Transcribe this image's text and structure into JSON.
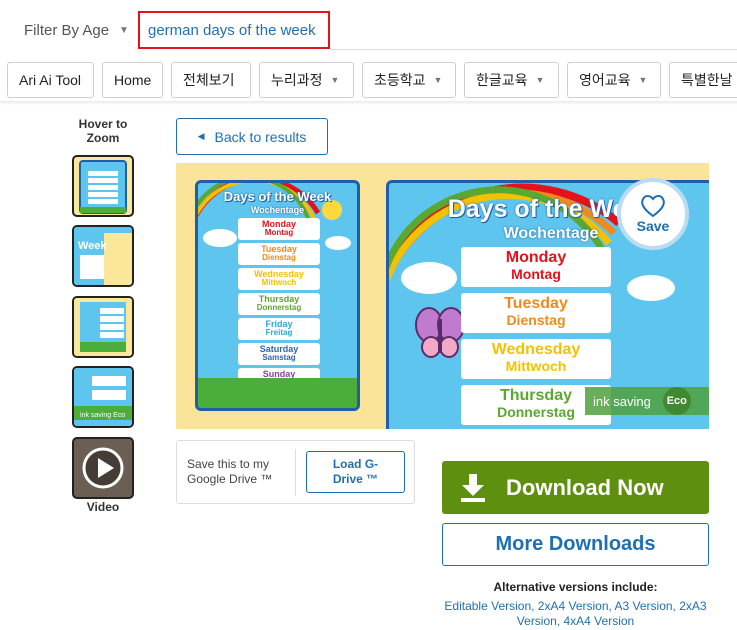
{
  "filter": {
    "label": "Filter By Age"
  },
  "search": {
    "value": "german days of the week"
  },
  "nav": [
    {
      "label": "Ari Ai Tool",
      "dropdown": false
    },
    {
      "label": "Home",
      "dropdown": false
    },
    {
      "label": "전체보기",
      "dropdown": false
    },
    {
      "label": "누리과정",
      "dropdown": true
    },
    {
      "label": "초등학교",
      "dropdown": true
    },
    {
      "label": "한글교육",
      "dropdown": true
    },
    {
      "label": "영어교육",
      "dropdown": true
    },
    {
      "label": "특별한날",
      "dropdown": false
    }
  ],
  "sidebar": {
    "hover_label": "Hover to Zoom",
    "video_label": "Video"
  },
  "back": {
    "label": "Back to results"
  },
  "resource": {
    "title": "Days of the Week",
    "subtitle": "Wochentage",
    "days": [
      {
        "en": "Monday",
        "de": "Montag",
        "color": "#e4131b"
      },
      {
        "en": "Tuesday",
        "de": "Dienstag",
        "color": "#f08a1c"
      },
      {
        "en": "Wednesday",
        "de": "Mittwoch",
        "color": "#f2c200"
      },
      {
        "en": "Thursday",
        "de": "Donnerstag",
        "color": "#59a832"
      },
      {
        "en": "Friday",
        "de": "Freitag",
        "color": "#2aa7d6"
      },
      {
        "en": "Saturday",
        "de": "Samstag",
        "color": "#2d63b0"
      },
      {
        "en": "Sunday",
        "de": "Sonntag",
        "color": "#8a3fa0"
      }
    ]
  },
  "save": {
    "label": "Save"
  },
  "ink": {
    "label": "ink saving",
    "eco": "Eco"
  },
  "gdrive": {
    "text": "Save this to my Google Drive ™",
    "button": "Load G-Drive ™"
  },
  "download": {
    "label": "Download Now"
  },
  "more": {
    "label": "More Downloads"
  },
  "alternatives": {
    "heading": "Alternative versions include:",
    "links": "Editable Version, 2xA4 Version, A3 Version, 2xA3 Version, 4xA4 Version"
  }
}
